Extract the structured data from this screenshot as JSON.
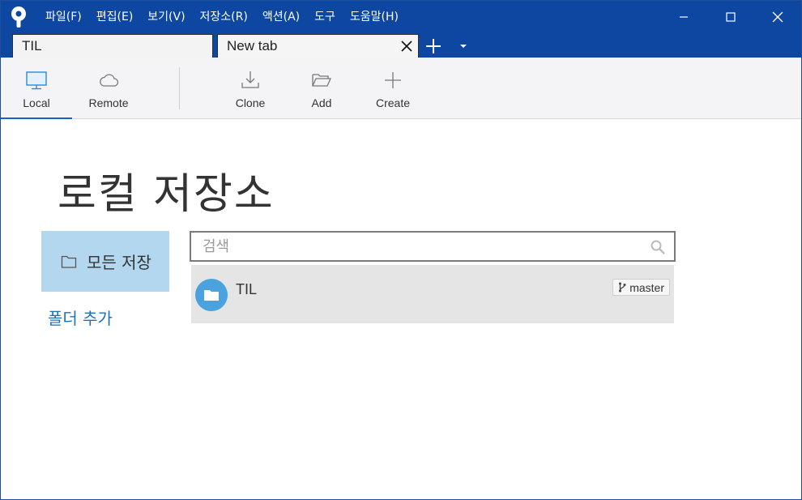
{
  "menu": [
    "파일(F)",
    "편집(E)",
    "보기(V)",
    "저장소(R)",
    "액션(A)",
    "도구",
    "도움말(H)"
  ],
  "tabs": {
    "til": "TIL",
    "new_tab": "New tab"
  },
  "toolbar": {
    "local": "Local",
    "remote": "Remote",
    "clone": "Clone",
    "add": "Add",
    "create": "Create"
  },
  "page": {
    "title": "로컬 저장소"
  },
  "sidebar": {
    "all_repos": "모든 저장",
    "add_folder": "폴더 추가"
  },
  "search": {
    "placeholder": "검색"
  },
  "repos": [
    {
      "name": "TIL",
      "branch": "master"
    }
  ],
  "colors": {
    "titlebar": "#0d47a1",
    "accent": "#1565c0",
    "selected": "#b3d7ee",
    "repo_icon": "#4aa3df",
    "link": "#1e6fb8"
  }
}
